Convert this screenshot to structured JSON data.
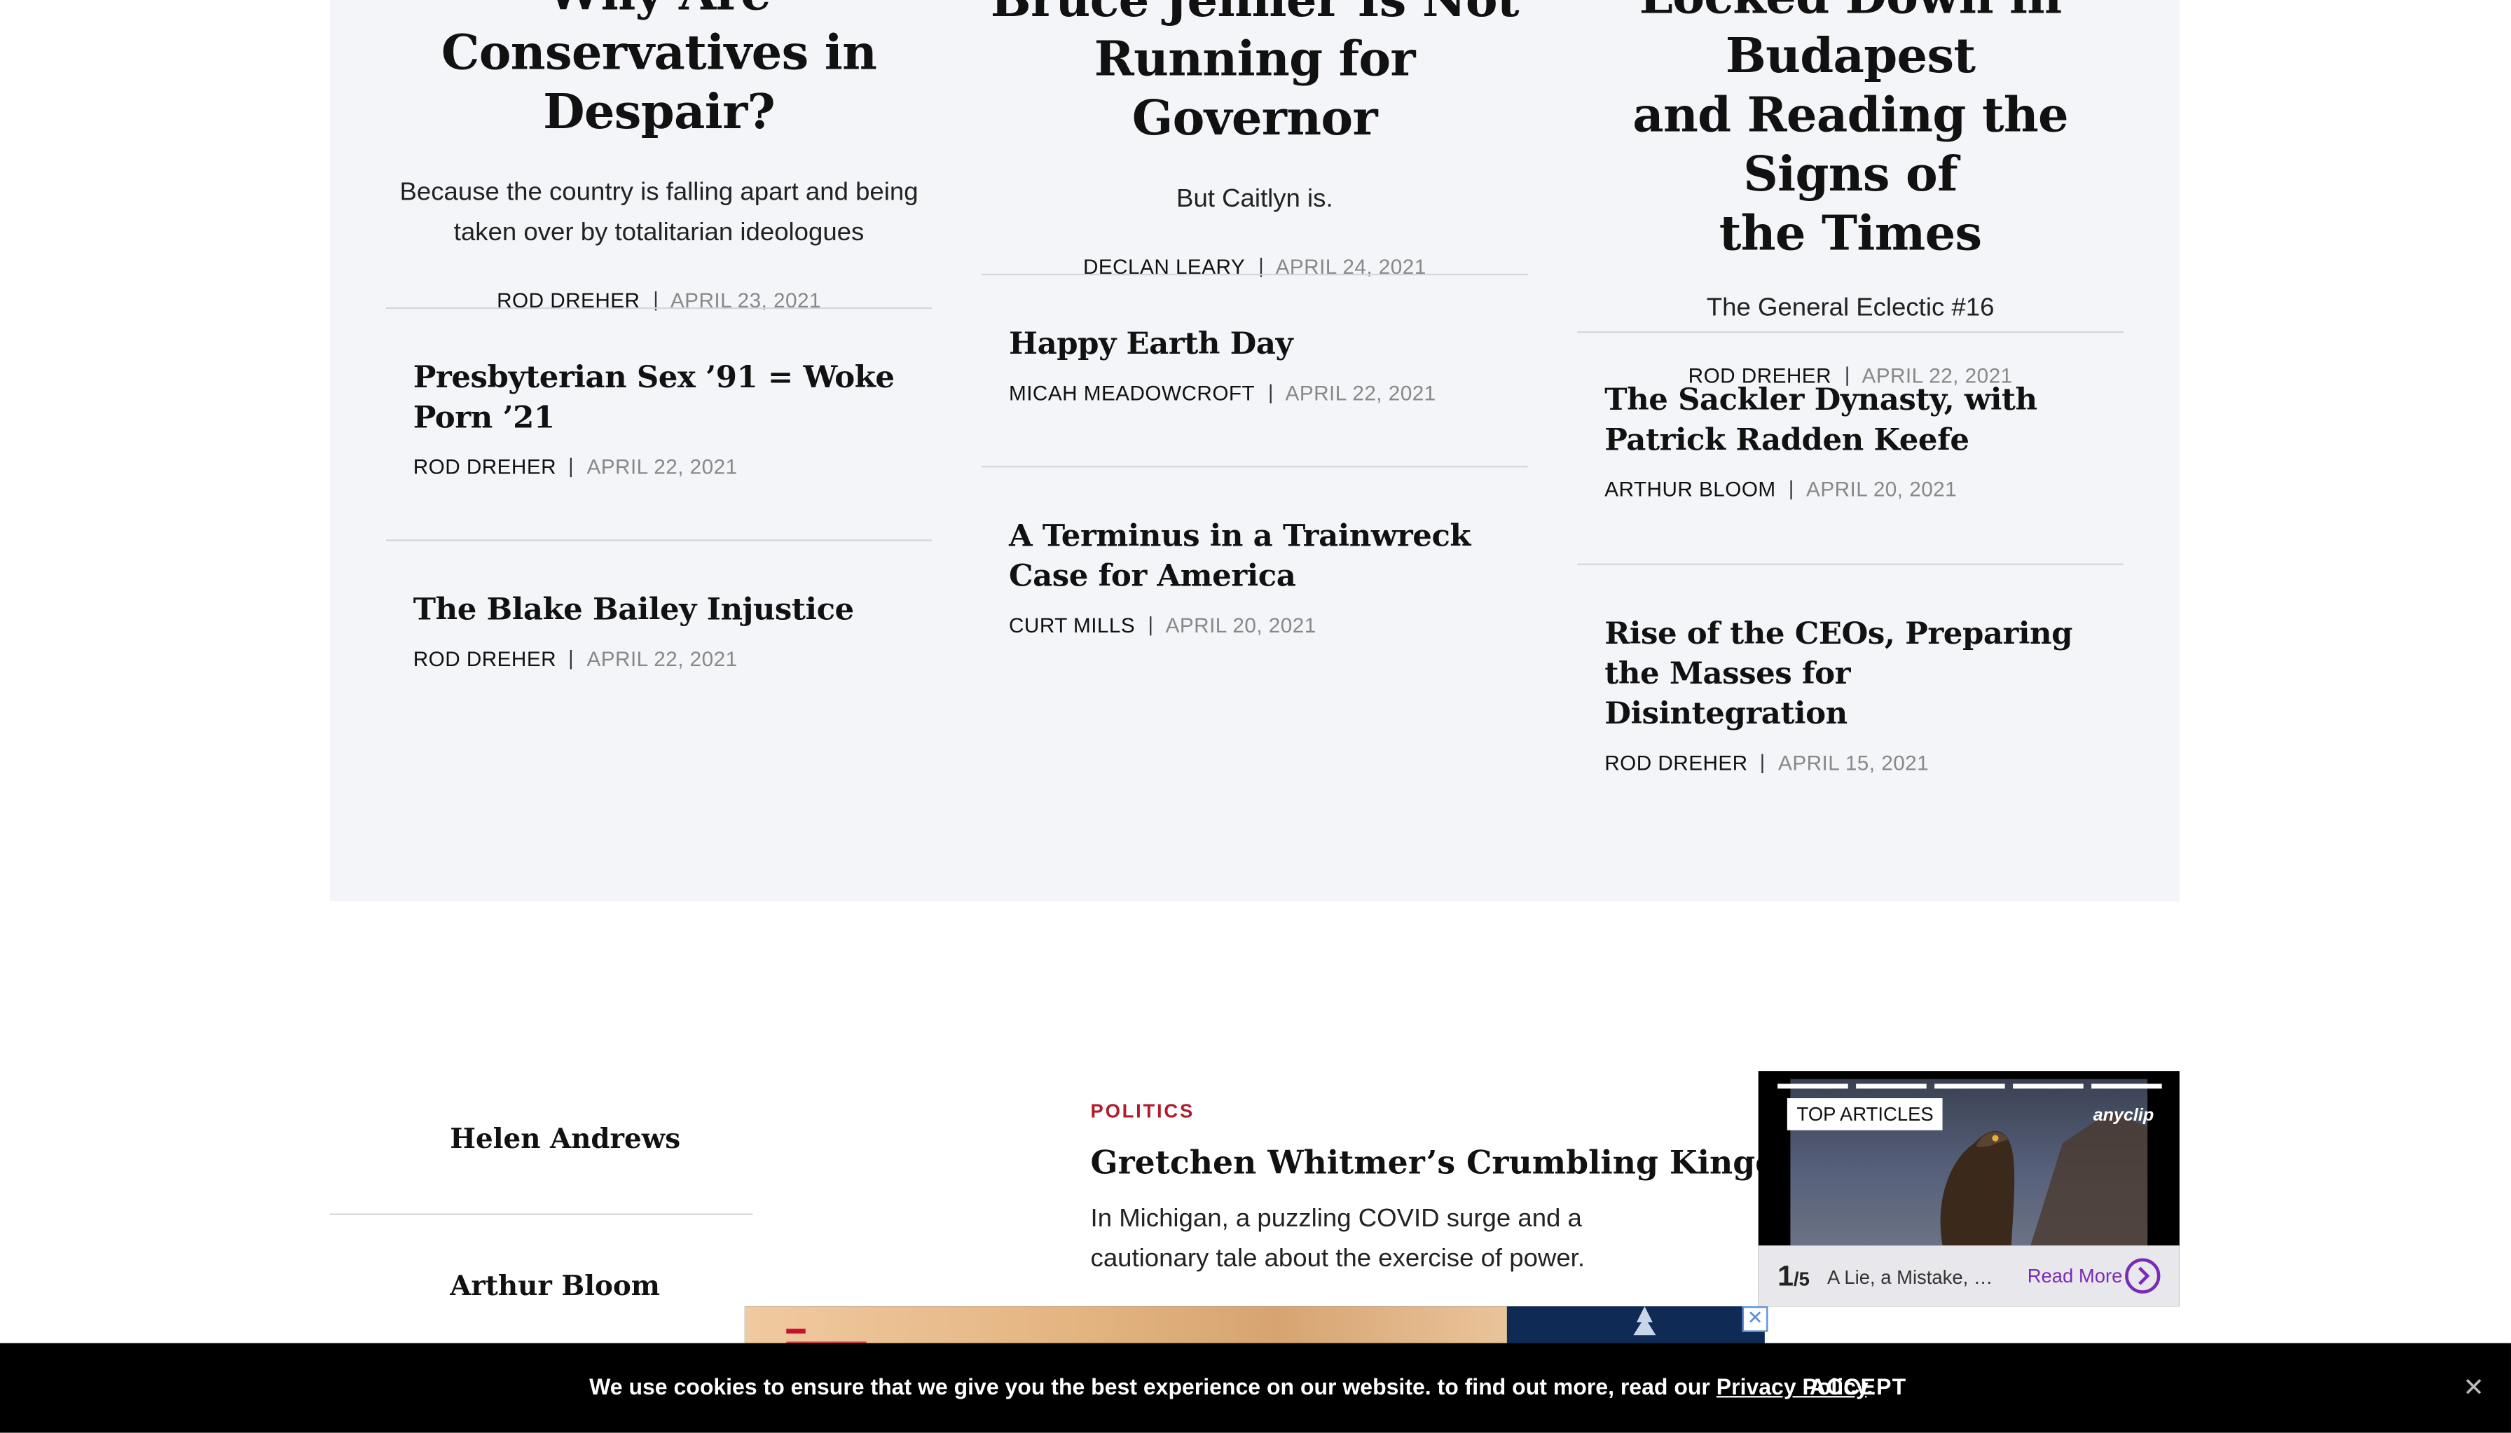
{
  "columns": [
    {
      "feature": {
        "title_line1": "Why Are Conservatives in",
        "title_line2": "Despair?",
        "dek": "Because the country is falling apart and being taken over by totalitarian ideologues",
        "author": "ROD DREHER",
        "date": "APRIL 23, 2021"
      },
      "stories": [
        {
          "title": "Presbyterian Sex ’91 = Woke Porn ’21",
          "author": "ROD DREHER",
          "date": "APRIL 22, 2021"
        },
        {
          "title": "The Blake Bailey Injustice",
          "author": "ROD DREHER",
          "date": "APRIL 22, 2021"
        }
      ]
    },
    {
      "feature": {
        "title_line1": "Bruce Jenner Is Not",
        "title_line2": "Running for Governor",
        "dek": "But Caitlyn is.",
        "author": "DECLAN LEARY",
        "date": "APRIL 24, 2021"
      },
      "stories": [
        {
          "title": "Happy Earth Day",
          "author": "MICAH MEADOWCROFT",
          "date": "APRIL 22, 2021"
        },
        {
          "title": "A Terminus in a Trainwreck Case for America",
          "author": "CURT MILLS",
          "date": "APRIL 20, 2021"
        }
      ]
    },
    {
      "feature": {
        "title_line1": "Locked Down in Budapest",
        "title_line2": "and Reading the Signs of",
        "title_line3": "the Times",
        "dek": "The General Eclectic #16",
        "author": "ROD DREHER",
        "date": "APRIL 22, 2021"
      },
      "stories": [
        {
          "title": "The Sackler Dynasty, with Patrick Radden Keefe",
          "author": "ARTHUR BLOOM",
          "date": "APRIL 20, 2021"
        },
        {
          "title": "Rise of the CEOs, Preparing the Masses for Disintegration",
          "author": "ROD DREHER",
          "date": "APRIL 15, 2021"
        }
      ]
    }
  ],
  "authors": [
    "Helen Andrews",
    "Arthur Bloom"
  ],
  "lower_article": {
    "kicker": "POLITICS",
    "title": "Gretchen Whitmer’s Crumbling Kingdom",
    "dek": "In Michigan, a puzzling COVID surge and a cautionary tale about the exercise of power."
  },
  "video_widget": {
    "badge": "TOP ARTICLES",
    "logo": "anyclip",
    "counter": "1",
    "counter_total": "/5",
    "caption": "A Lie, a Mistake, o…",
    "read_more": "Read More",
    "progress_segments": 5
  },
  "ad": {
    "close_label": "✕"
  },
  "cookie_bar": {
    "text": "We use cookies to ensure that we give you the best experience on our website. to find out more, read our",
    "link": "Privacy Policy",
    "period": ".",
    "accept": "ACCEPT",
    "close": "✕"
  }
}
